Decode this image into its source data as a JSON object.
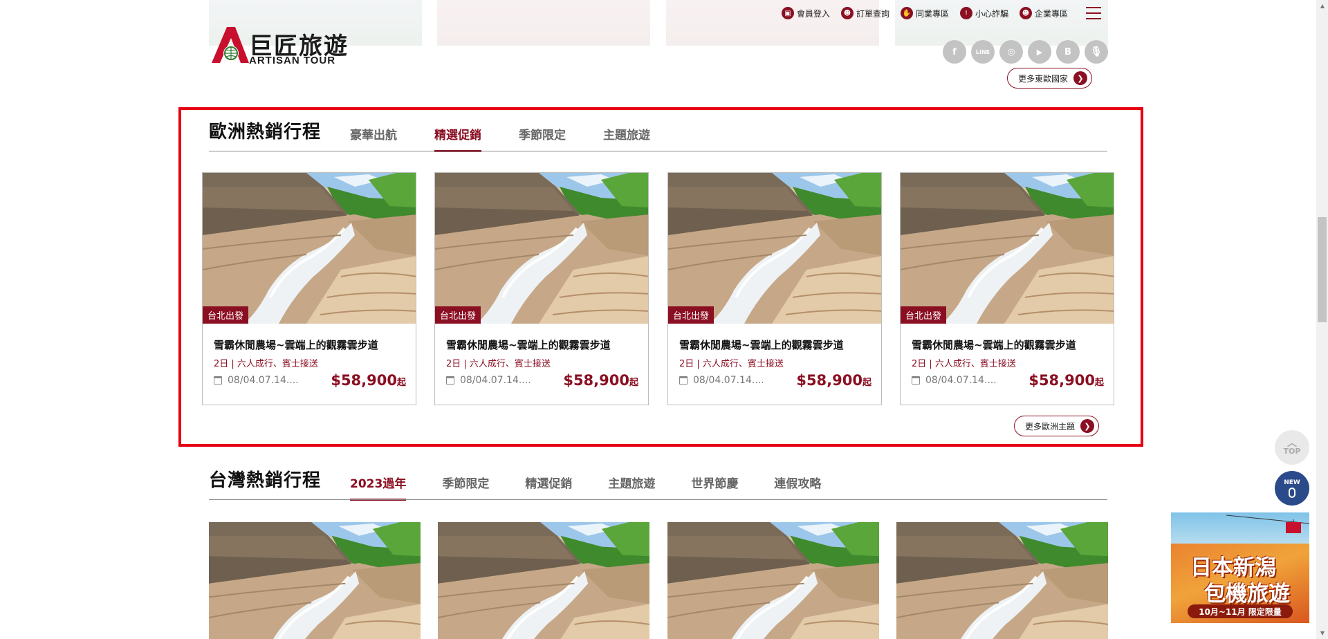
{
  "header": {
    "logo_zh": "巨匠旅遊",
    "logo_en": "ARTISAN TOUR",
    "nav": [
      {
        "label": "會員登入",
        "icon": "lock-icon"
      },
      {
        "label": "訂單查詢",
        "icon": "users-icon"
      },
      {
        "label": "同業專區",
        "icon": "handshake-icon"
      },
      {
        "label": "小心詐騙",
        "icon": "warning-icon"
      },
      {
        "label": "企業專區",
        "icon": "users-icon"
      }
    ],
    "menu_icon": "hamburger-icon",
    "social": [
      {
        "name": "facebook-icon",
        "glyph": "f"
      },
      {
        "name": "line-icon",
        "glyph": "LINE"
      },
      {
        "name": "instagram-icon",
        "glyph": "◎"
      },
      {
        "name": "youtube-icon",
        "glyph": "▶"
      },
      {
        "name": "blog-icon",
        "glyph": "B"
      },
      {
        "name": "podcast-icon",
        "glyph": "🎙"
      }
    ],
    "more_label": "更多東歐國家"
  },
  "europe": {
    "title": "歐洲熱銷行程",
    "tabs": [
      "豪華出航",
      "精選促銷",
      "季節限定",
      "主題旅遊"
    ],
    "active_tab": 1,
    "cards": [
      {
        "badge": "台北出發",
        "title": "雪霸休閒農場~雲端上的觀霧雲步道",
        "sub": "2日 | 六人成行、賓士接送",
        "date": "08/04.07.14....",
        "price": "$58,900",
        "price_unit": "起"
      },
      {
        "badge": "台北出發",
        "title": "雪霸休閒農場~雲端上的觀霧雲步道",
        "sub": "2日 | 六人成行、賓士接送",
        "date": "08/04.07.14....",
        "price": "$58,900",
        "price_unit": "起"
      },
      {
        "badge": "台北出發",
        "title": "雪霸休閒農場~雲端上的觀霧雲步道",
        "sub": "2日 | 六人成行、賓士接送",
        "date": "08/04.07.14....",
        "price": "$58,900",
        "price_unit": "起"
      },
      {
        "badge": "台北出發",
        "title": "雪霸休閒農場~雲端上的觀霧雲步道",
        "sub": "2日 | 六人成行、賓士接送",
        "date": "08/04.07.14....",
        "price": "$58,900",
        "price_unit": "起"
      }
    ],
    "more_label": "更多歐洲主題"
  },
  "taiwan": {
    "title": "台灣熱銷行程",
    "tabs": [
      "2023過年",
      "季節限定",
      "精選促銷",
      "主題旅遊",
      "世界節慶",
      "連假攻略"
    ],
    "active_tab": 0
  },
  "floating": {
    "top_label": "TOP",
    "new_label": "NEW",
    "ad_line1": "日本新潟",
    "ad_line2": "包機旅遊",
    "ad_footer": "10月~11月 限定限量"
  },
  "colors": {
    "brand": "#8b0f22",
    "highlight": "#e60012",
    "social": "#c3c3c3"
  }
}
